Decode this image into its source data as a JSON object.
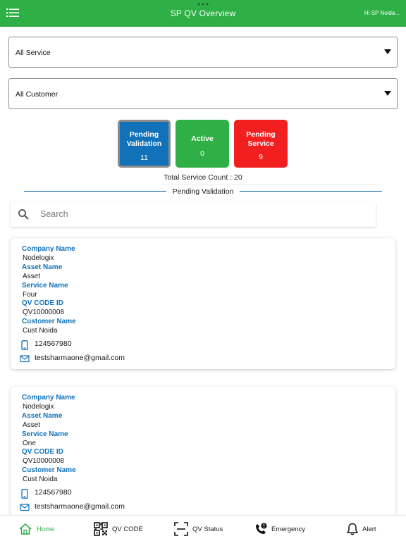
{
  "header": {
    "title": "SP QV Overview",
    "greeting": "Hi SP Noida...",
    "menu_icon": "hamburger-menu-icon",
    "brand_color": "#2fb046"
  },
  "filters": {
    "service_select": "All Service",
    "customer_select": "All Customer"
  },
  "stats": [
    {
      "label_line1": "Pending",
      "label_line2": "Validation",
      "count": "11",
      "color": "#1172b9"
    },
    {
      "label_line1": "Active",
      "label_line2": "",
      "count": "0",
      "color": "#2fb046"
    },
    {
      "label_line1": "Pending",
      "label_line2": "Service",
      "count": "9",
      "color": "#f11f1f"
    }
  ],
  "total_service_count": "Total Service Count  : 20",
  "section_title": "Pending Validation",
  "search": {
    "placeholder": "Search",
    "value": ""
  },
  "records": [
    {
      "company_label": "Company Name",
      "company": "Nodelogix",
      "asset_label": "Asset Name",
      "asset": "Asset",
      "service_label": "Service Name",
      "service": "Four",
      "qv_label": "QV CODE ID",
      "qv": "QV10000008",
      "customer_label": "Customer Name",
      "customer": "Cust Noida",
      "phone": "124567980",
      "email": "testsharmaone@gmail.com"
    },
    {
      "company_label": "Company Name",
      "company": "Nodelogix",
      "asset_label": "Asset Name",
      "asset": "Asset",
      "service_label": "Service Name",
      "service": "One",
      "qv_label": "QV CODE ID",
      "qv": "QV10000008",
      "customer_label": "Customer Name",
      "customer": "Cust Noida",
      "phone": "124567980",
      "email": "testsharmaone@gmail.com"
    }
  ],
  "tabs": [
    {
      "label": "Home",
      "icon": "home-icon",
      "active": true
    },
    {
      "label": "QV CODE",
      "icon": "qr-code-icon",
      "active": false
    },
    {
      "label": "QV Status",
      "icon": "scan-icon",
      "active": false
    },
    {
      "label": "Emergency",
      "icon": "phone-alert-icon",
      "active": false
    },
    {
      "label": "Alert",
      "icon": "bell-icon",
      "active": false
    }
  ],
  "colors": {
    "accent_blue": "#1172b9",
    "green": "#2fb046",
    "red": "#f11f1f"
  }
}
